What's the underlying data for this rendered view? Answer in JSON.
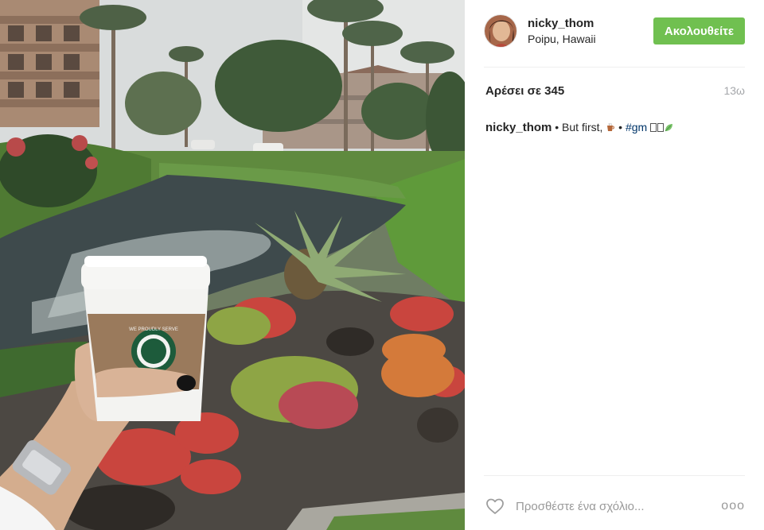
{
  "post": {
    "username": "nicky_thom",
    "location": "Poipu, Hawaii",
    "follow_label": "Ακολουθείτε",
    "likes_text": "Αρέσει σε 345",
    "age": "13ω",
    "caption": {
      "username": "nicky_thom",
      "text_before": " • But first, ",
      "bullet": " • ",
      "hashtag": "#gm"
    },
    "comment_placeholder": "Προσθέστε ένα σχόλιο...",
    "more_label": "ooo"
  },
  "photo": {
    "cup_text": "WE PROUDLY SERVE"
  },
  "icons": {
    "heart": "heart-icon",
    "coffee_emoji": "coffee-icon",
    "leaf_emoji": "leaf-icon",
    "more": "more-options-icon"
  },
  "colors": {
    "follow_button": "#70c050",
    "hashtag": "#003569",
    "muted_text": "#999999"
  }
}
